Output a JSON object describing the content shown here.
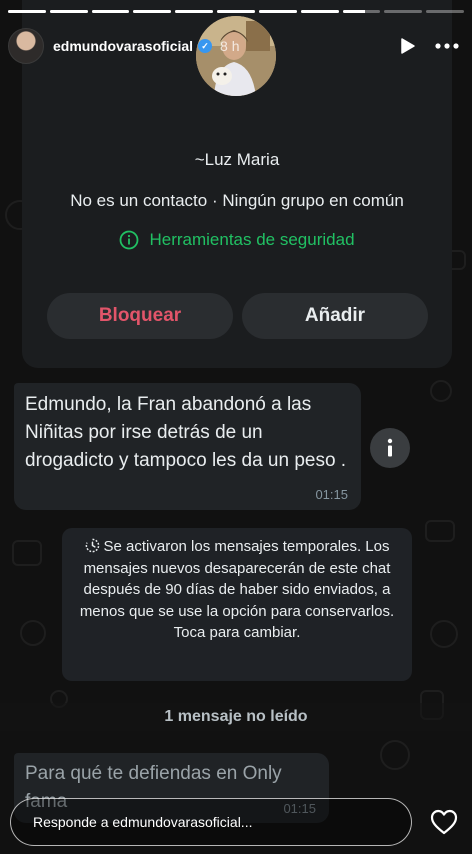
{
  "story": {
    "username": "edmundovarasoficial",
    "time_ago": "8 h",
    "progress_segments": [
      1,
      1,
      1,
      1,
      1,
      1,
      1,
      1,
      0.6,
      0,
      0
    ],
    "reply_placeholder": "Responde a edmundovarasoficial...",
    "icons": {
      "verified": "verified-badge-icon",
      "play": "play-icon",
      "more": "more-dots-icon",
      "like": "heart-icon"
    }
  },
  "contact": {
    "name": "~Luz Maria",
    "meta": "No es un contacto · Ningún grupo en común",
    "safety_tools": "Herramientas de seguridad",
    "block_label": "Bloquear",
    "add_label": "Añadir"
  },
  "messages": [
    {
      "text": "Edmundo, la Fran abandonó a las Niñitas por irse detrás de un drogadicto y tampoco les da un peso .",
      "time": "01:15"
    },
    {
      "text": "Para qué te defiendas en Only fama",
      "time": "01:15"
    }
  ],
  "system_notice": "Se activaron los mensajes temporales. Los mensajes nuevos desaparecerán de este chat después de 90 días de haber sido enviados, a menos que se use la opción para conservarlos. Toca para cambiar.",
  "unread_label": "1 mensaje no leído",
  "colors": {
    "accent_green": "#21c063",
    "block_red": "#e2556a",
    "bubble": "#202326",
    "card": "#1b1d1f"
  }
}
